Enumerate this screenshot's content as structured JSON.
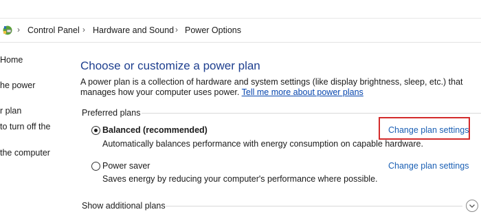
{
  "breadcrumb": {
    "icon": "control-panel-icon",
    "items": [
      "Control Panel",
      "Hardware and Sound",
      "Power Options"
    ]
  },
  "sidebar": {
    "items": [
      {
        "label": "Home"
      },
      {
        "label": "he power"
      },
      {
        "label": "r plan"
      },
      {
        "label": "to turn off the"
      },
      {
        "label": "the computer"
      }
    ]
  },
  "main": {
    "title": "Choose or customize a power plan",
    "description": "A power plan is a collection of hardware and system settings (like display brightness, sleep, etc.) that manages how your computer uses power.",
    "description_link": "Tell me more about power plans",
    "preferred_label": "Preferred plans",
    "plans": [
      {
        "name": "Balanced (recommended)",
        "selected": true,
        "description": "Automatically balances performance with energy consumption on capable hardware.",
        "link": "Change plan settings"
      },
      {
        "name": "Power saver",
        "selected": false,
        "description": "Saves energy by reducing your computer's performance where possible.",
        "link": "Change plan settings"
      }
    ],
    "additional_label": "Show additional plans"
  },
  "colors": {
    "highlight": "#d32a2a",
    "link": "#1a5fb4",
    "title": "#1e3f8f"
  }
}
